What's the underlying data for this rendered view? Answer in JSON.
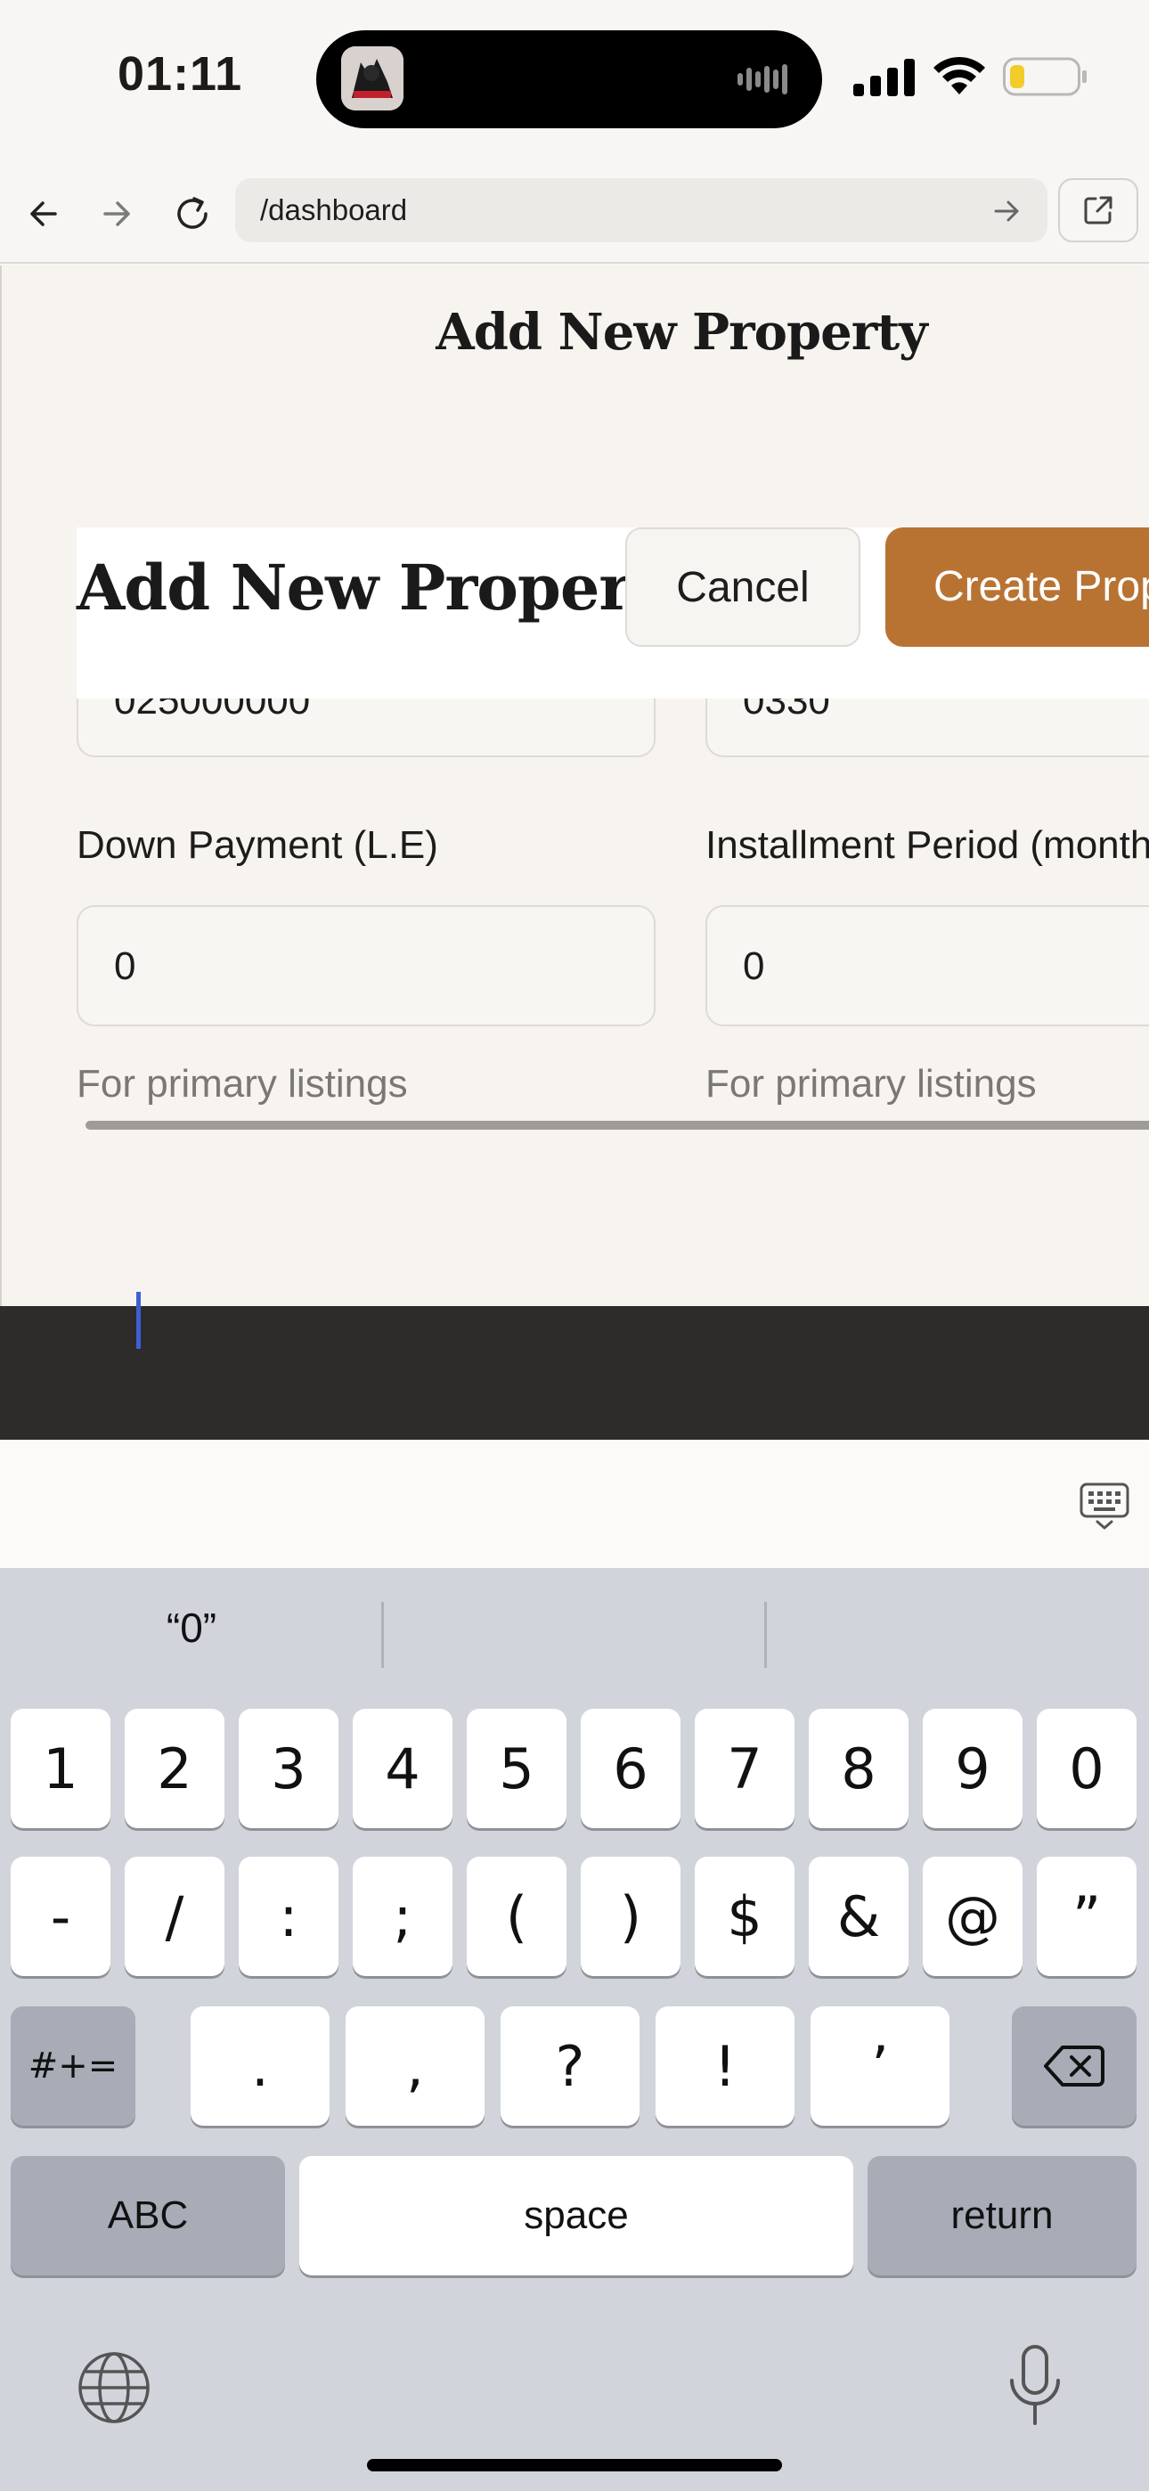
{
  "status_bar": {
    "time": "01:11",
    "battery_color": "#f1cc2b"
  },
  "browser": {
    "url": "/dashboard",
    "icons": [
      "back-arrow-icon",
      "forward-arrow-icon",
      "reload-icon",
      "go-arrow-icon",
      "open-external-icon"
    ]
  },
  "page": {
    "heading": "Add New Property",
    "sticky_header": {
      "title": "Add New Property",
      "cancel_label": "Cancel",
      "create_label": "Create Property"
    },
    "cutoff_fields": {
      "left_value": "025000000",
      "right_value": "0330"
    },
    "down_payment": {
      "label": "Down Payment (L.E)",
      "value": "0",
      "helper": "For primary listings"
    },
    "installment_period": {
      "label": "Installment Period (months)",
      "value": "0",
      "helper": "For primary listings"
    },
    "accent_color": "#b87333"
  },
  "keyboard": {
    "suggestion": "“0”",
    "row1": [
      "1",
      "2",
      "3",
      "4",
      "5",
      "6",
      "7",
      "8",
      "9",
      "0"
    ],
    "row2": [
      "-",
      "/",
      ":",
      ";",
      "(",
      ")",
      "$",
      "&",
      "@",
      "”"
    ],
    "row3_left": "#+=",
    "row3": [
      ".",
      ",",
      "?",
      "!",
      "’"
    ],
    "abc_label": "ABC",
    "space_label": "space",
    "return_label": "return"
  }
}
